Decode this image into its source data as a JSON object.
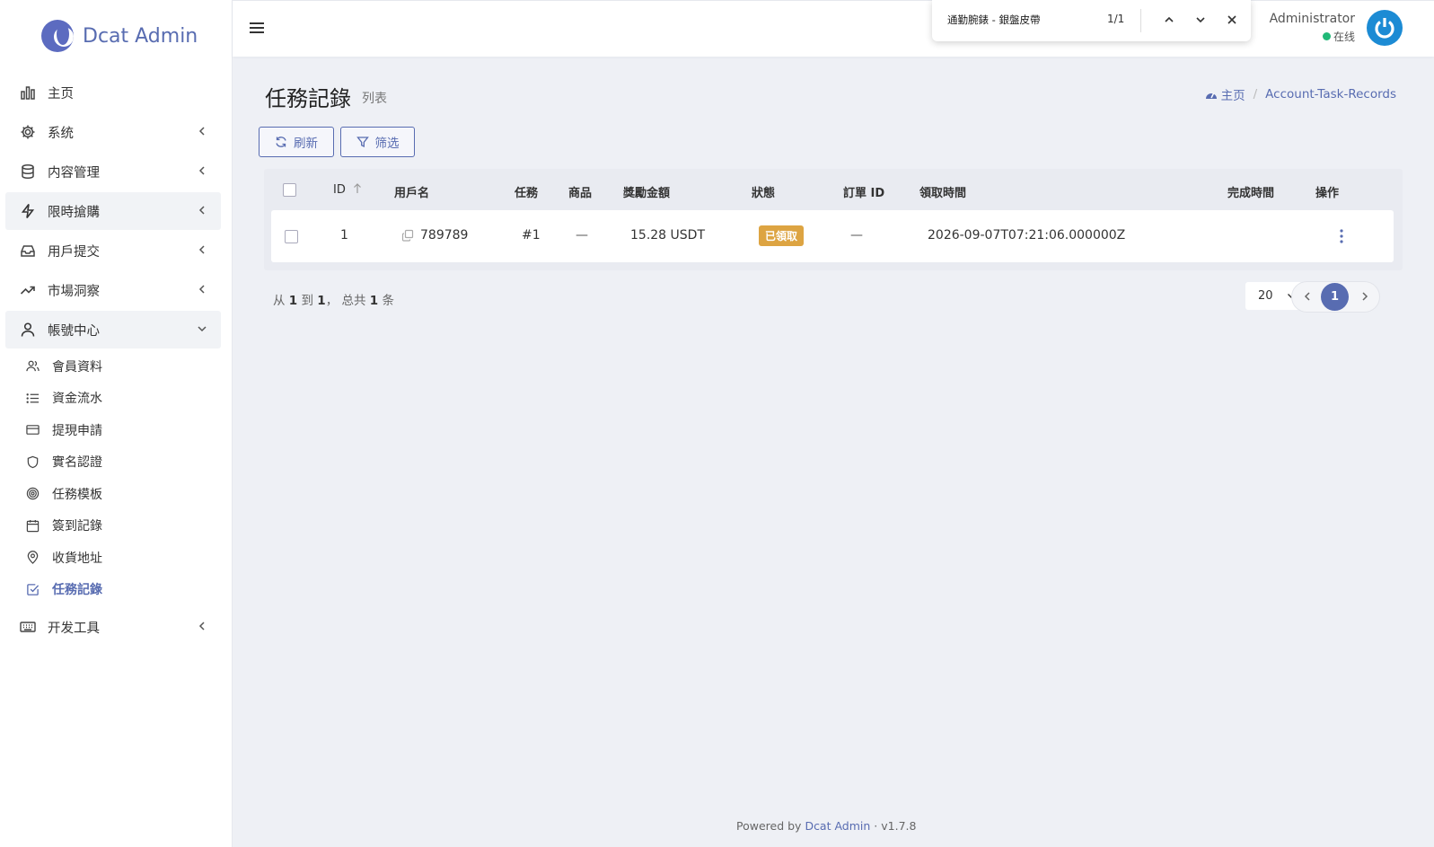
{
  "brand": {
    "name": "Dcat Admin"
  },
  "sidebar": {
    "items": [
      {
        "label": "主页",
        "icon": "bar-chart-icon",
        "caret": false
      },
      {
        "label": "系统",
        "icon": "gear-icon",
        "caret": true
      },
      {
        "label": "内容管理",
        "icon": "database-icon",
        "caret": true
      },
      {
        "label": "限時搶購",
        "icon": "lightning-icon",
        "caret": true,
        "active": true
      },
      {
        "label": "用戶提交",
        "icon": "inbox-icon",
        "caret": true
      },
      {
        "label": "市場洞察",
        "icon": "trending-up-icon",
        "caret": true
      },
      {
        "label": "帳號中心",
        "icon": "user-icon",
        "caret": "down",
        "active": true
      }
    ],
    "subitems": [
      {
        "label": "會員資料",
        "icon": "users-icon"
      },
      {
        "label": "資金流水",
        "icon": "list-icon"
      },
      {
        "label": "提現申請",
        "icon": "credit-card-icon"
      },
      {
        "label": "實名認證",
        "icon": "shield-icon"
      },
      {
        "label": "任務模板",
        "icon": "target-icon"
      },
      {
        "label": "簽到記錄",
        "icon": "calendar-icon"
      },
      {
        "label": "收貨地址",
        "icon": "map-pin-icon"
      },
      {
        "label": "任務記錄",
        "icon": "check-square-icon",
        "current": true
      }
    ],
    "dev": {
      "label": "开发工具",
      "icon": "keyboard-icon"
    }
  },
  "findbar": {
    "query": "通勤腕錶 - 銀盤皮帶",
    "count": "1/1"
  },
  "user": {
    "name": "Administrator",
    "status": "在线"
  },
  "page": {
    "title": "任務記錄",
    "subtitle": "列表"
  },
  "breadcrumb": {
    "home": "主页",
    "current": "Account-Task-Records"
  },
  "toolbar": {
    "refresh": "刷新",
    "filter": "筛选"
  },
  "table": {
    "headers": {
      "id": "ID",
      "username": "用戶名",
      "task": "任務",
      "product": "商品",
      "reward": "獎勵金額",
      "status": "狀態",
      "order_id": "訂單 ID",
      "claimed_at": "領取時間",
      "completed_at": "完成時間",
      "actions": "操作"
    },
    "rows": [
      {
        "id": "1",
        "username": "789789",
        "task": "#1",
        "product": "—",
        "reward": "15.28 USDT",
        "status": "已領取",
        "order_id": "—",
        "claimed_at": "2026-09-07T07:21:06.000000Z",
        "completed_at": ""
      }
    ]
  },
  "pagination": {
    "prefix": "从",
    "from": "1",
    "to_word": "到",
    "to": "1",
    "total_prefix": "，  总共",
    "total": "1",
    "unit": "条",
    "per_page": "20",
    "current_page": "1"
  },
  "footer": {
    "prefix": "Powered by",
    "link": "Dcat Admin",
    "sep": "·",
    "version": "v1.7.8"
  },
  "colors": {
    "primary": "#586cb1",
    "badge": "#dda442",
    "online": "#21b978"
  }
}
